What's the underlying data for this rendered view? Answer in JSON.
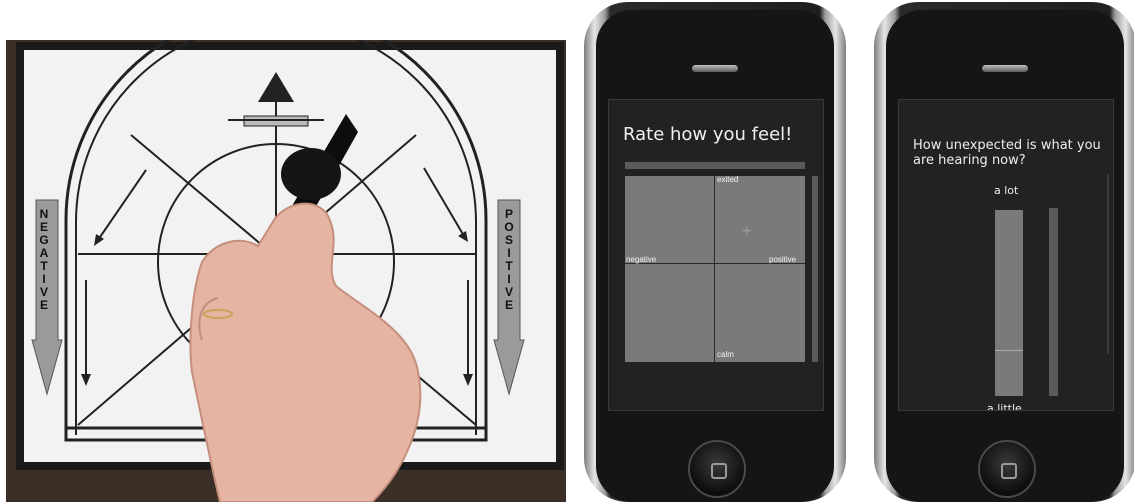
{
  "left_panel": {
    "negative_label": "NEGATIVE",
    "positive_label": "POSITIVE"
  },
  "phone1": {
    "title": "Rate how you feel!",
    "label_top": "exited",
    "label_left": "negative",
    "label_right": "positive",
    "label_bottom": "calm",
    "cursor_glyph": "+"
  },
  "phone2": {
    "question": "How unexpected is what you are hearing now?",
    "top_label": "a lot",
    "bottom_label": "a little",
    "slider_value_fraction": 0.25
  }
}
